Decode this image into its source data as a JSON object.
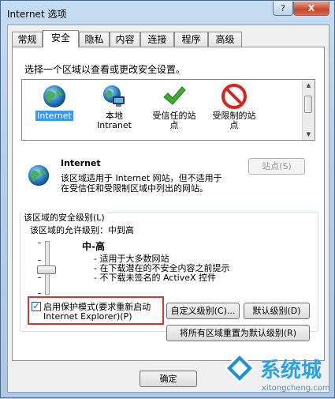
{
  "window": {
    "title": "Internet 选项",
    "help_label": "?",
    "close_label": "X"
  },
  "tabs": [
    {
      "label": "常规",
      "active": false
    },
    {
      "label": "安全",
      "active": true
    },
    {
      "label": "隐私",
      "active": false
    },
    {
      "label": "内容",
      "active": false
    },
    {
      "label": "连接",
      "active": false
    },
    {
      "label": "程序",
      "active": false
    },
    {
      "label": "高级",
      "active": false
    }
  ],
  "security": {
    "zone_prompt": "选择一个区域以查看或更改安全设置。",
    "zones": [
      {
        "label": "Internet",
        "icon": "globe-icon",
        "selected": true
      },
      {
        "label": "本地\nIntranet",
        "icon": "intranet-icon",
        "selected": false
      },
      {
        "label": "受信任的站\n点",
        "icon": "checkmark-icon",
        "selected": false
      },
      {
        "label": "受限制的站\n点",
        "icon": "restricted-icon",
        "selected": false
      }
    ],
    "zone_title": "Internet",
    "zone_desc_line1": "该区域适用于 Internet 网站，但不适用于",
    "zone_desc_line2": "在受信任和受限制区域中列出的网站。",
    "sites_button": "站点(S)",
    "level_group_label": "该区域的安全级别(L)",
    "allowed_levels": "该区域的允许级别：中到高",
    "level_name": "中-高",
    "level_points": [
      "- 适用于大多数网站",
      "- 在下载潜在的不安全内容之前提示",
      "- 不下载未签名的 ActiveX 控件"
    ],
    "slider_level": 3,
    "slider_levels_total": 4,
    "protected_mode_line1": "启用保护模式(要求重新启动",
    "protected_mode_line2": "Internet Explorer)(P)",
    "protected_mode_checked": true,
    "custom_level_button": "自定义级别(C)...",
    "default_level_button": "默认级别(D)",
    "reset_all_button": "将所有区域重置为默认级别(R)"
  },
  "footer": {
    "ok_button": "确定"
  },
  "watermark": {
    "brand": "系统城",
    "url": "xitongcheng.com"
  },
  "colors": {
    "accent": "#3399ff",
    "highlight_border": "#e0302a"
  }
}
